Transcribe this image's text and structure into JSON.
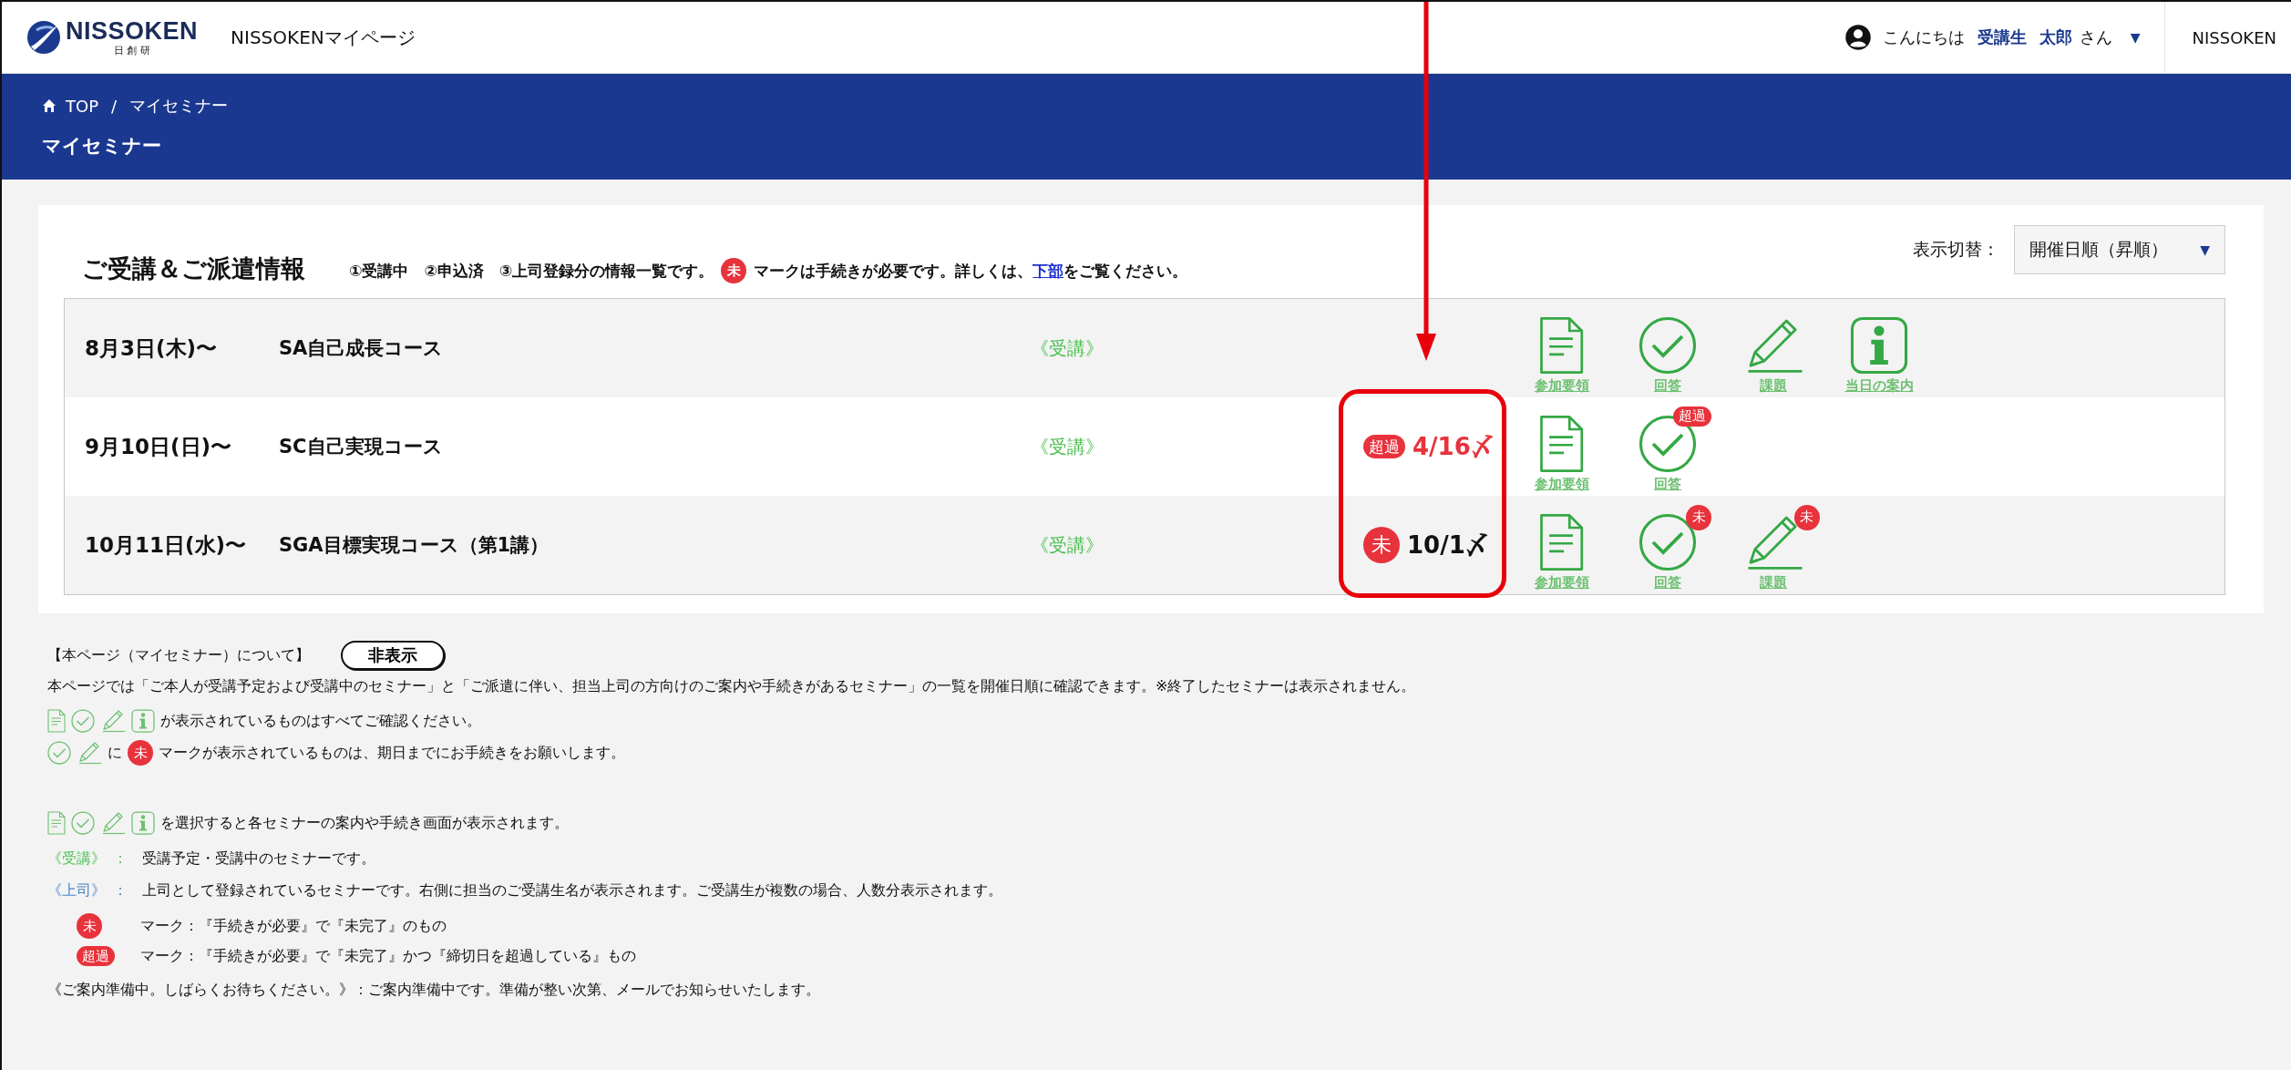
{
  "header": {
    "logo": {
      "name": "NISSOKEN",
      "sub": "日 創 研"
    },
    "site_title": "NISSOKENマイページ",
    "greeting": {
      "hello": "こんにちは",
      "role": "受講生",
      "user": "太郎",
      "suffix": "さん",
      "caret": "▼"
    },
    "nav_link": "NISSOKEN"
  },
  "breadcrumb": {
    "items": [
      "TOP",
      "マイセミナー"
    ],
    "separator": "/"
  },
  "page_title": "マイセミナー",
  "section": {
    "title": "ご受講＆ご派遣情報",
    "note": "①受講中　②申込済　③上司登録分の情報一覧です。",
    "badge": "未",
    "note_after": "マークは手続きが必要です。詳しくは、",
    "link": "下部",
    "note_end": "をご覧ください。",
    "sort": {
      "label": "表示切替：",
      "value": "開催日順（昇順）",
      "caret": "▼"
    }
  },
  "rows": [
    {
      "date": "8月3日(木)〜",
      "course": "SA自己成長コース",
      "type": "《受講》",
      "actions": [
        {
          "kind": "guide",
          "label": "参加要領"
        },
        {
          "kind": "answer",
          "label": "回答"
        },
        {
          "kind": "task",
          "label": "課題"
        },
        {
          "kind": "info",
          "label": "当日の案内"
        }
      ]
    },
    {
      "date": "9月10日(日)〜",
      "course": "SC自己実現コース",
      "type": "《受講》",
      "status": {
        "kind": "overdue",
        "badge": "超過",
        "deadline": "4/16〆"
      },
      "actions": [
        {
          "kind": "guide",
          "label": "参加要領"
        },
        {
          "kind": "answer",
          "label": "回答",
          "badge": {
            "kind": "overdue",
            "text": "超過"
          }
        }
      ]
    },
    {
      "date": "10月11日(水)〜",
      "course": "SGA目標実現コース（第1講）",
      "type": "《受講》",
      "status": {
        "kind": "pending",
        "badge": "未",
        "deadline": "10/1〆"
      },
      "actions": [
        {
          "kind": "guide",
          "label": "参加要領"
        },
        {
          "kind": "answer",
          "label": "回答",
          "badge": {
            "kind": "pending",
            "text": "未"
          }
        },
        {
          "kind": "task",
          "label": "課題",
          "badge": {
            "kind": "pending",
            "text": "未"
          }
        }
      ]
    }
  ],
  "about": {
    "title": "【本ページ（マイセミナー）について】",
    "toggle": "非表示",
    "description": "本ページでは「ご本人が受講予定および受講中のセミナー」と「ご派遣に伴い、担当上司の方向けのご案内や手続きがあるセミナー」の一覧を開催日順に確認できます。※終了したセミナーは表示されません。",
    "lines": [
      [
        {
          "kind": "guide"
        },
        {
          "kind": "answer"
        },
        {
          "kind": "task"
        },
        {
          "kind": "info"
        },
        {
          "kind": "text",
          "text": "が表示されているものはすべてご確認ください。"
        }
      ],
      [
        {
          "kind": "answer"
        },
        {
          "kind": "task"
        },
        {
          "kind": "text",
          "text": "に"
        },
        {
          "kind": "pending",
          "text": "未"
        },
        {
          "kind": "text",
          "text": "マークが表示されているものは、期日までにお手続きをお願いします。"
        }
      ],
      [
        {
          "kind": "guide"
        },
        {
          "kind": "answer"
        },
        {
          "kind": "task"
        },
        {
          "kind": "info"
        },
        {
          "kind": "text",
          "text": "を選択すると各セミナーの案内や手続き画面が表示されます。"
        }
      ]
    ],
    "types": [
      {
        "label": "《受講》",
        "color": "#4cbf52",
        "sep": "：",
        "text": "受講予定・受講中のセミナーです。"
      },
      {
        "label": "《上司》",
        "color": "#4f86c6",
        "sep": "：",
        "text": "上司として登録されているセミナーです。右側に担当のご受講生名が表示されます。ご受講生が複数の場合、人数分表示されます。"
      }
    ],
    "marks": [
      {
        "kind": "pending",
        "badge": "未",
        "text": "マーク：『手続きが必要』で『未完了』のもの"
      },
      {
        "kind": "overdue",
        "badge": "超過",
        "text": "マーク：『手続きが必要』で『未完了』かつ『締切日を超過している』もの"
      }
    ],
    "footer": "《ご案内準備中。しばらくお待ちください。》：ご案内準備中です。準備が整い次第、メールでお知らせいたします。"
  }
}
